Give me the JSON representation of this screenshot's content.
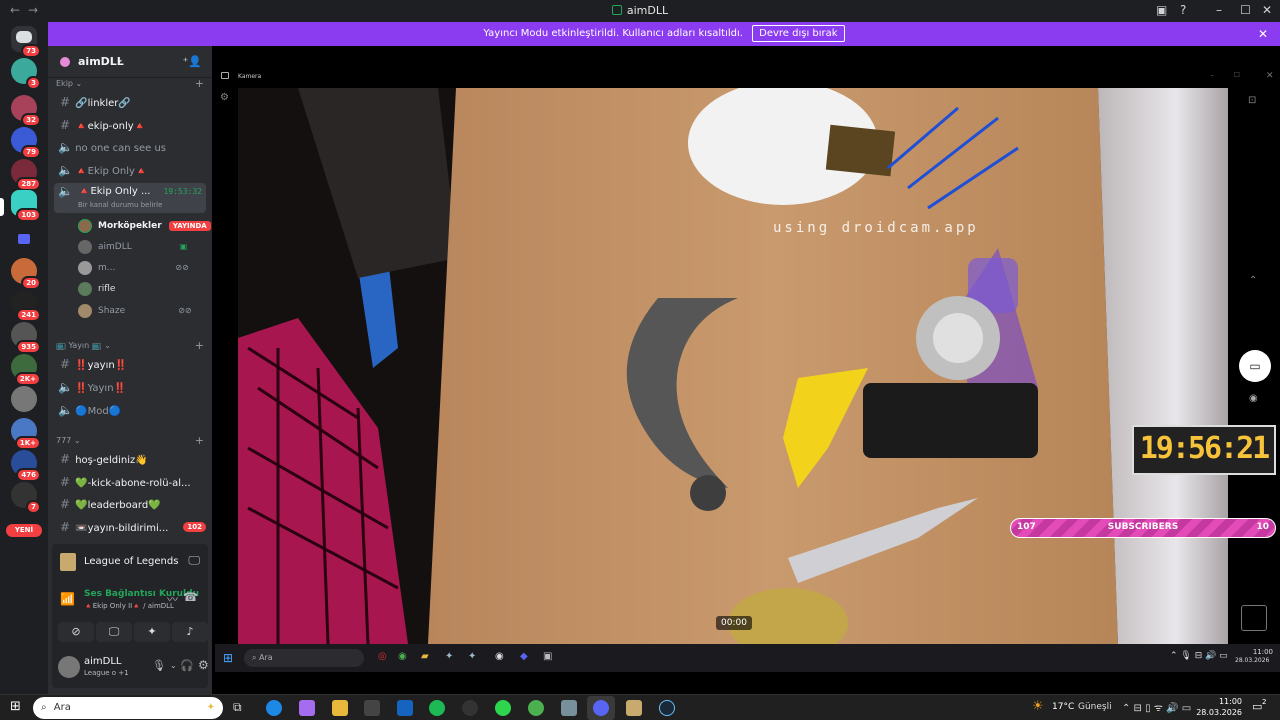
{
  "window": {
    "title": "aimDLL"
  },
  "banner": {
    "text": "Yayıncı Modu etkinleştirildi. Kullanıcı adları kısaltıldı.",
    "button": "Devre dışı bırak"
  },
  "rail": {
    "badges": [
      "73",
      "3",
      "32",
      "79",
      "287",
      "103",
      "20",
      "241",
      "935",
      "2K+",
      "1K+",
      "476",
      "7"
    ],
    "new_label": "YENİ"
  },
  "server": {
    "name": "aimDLL"
  },
  "categories": {
    "ekip": "Ekip",
    "yayin": "📺 Yayın 📺",
    "c777": "777"
  },
  "channels": {
    "linkler": "🔗linkler🔗",
    "ekip_only": "🔺ekip-only🔺",
    "no_one": "no one can see us",
    "ekip_only_voice": "🔺Ekip Only🔺",
    "ekip_only_active": "🔺Ekip Only ...",
    "active_time": "19:53:32",
    "active_status": "Bir kanal durumu belirle",
    "yayin1": "‼️yayın‼️",
    "yayin2": "‼️Yayın‼️",
    "mod": "🔵Mod🔵",
    "hos_geldiniz": "hoş-geldiniz👋",
    "kick_abone": "💚-kick-abone-rolü-al...",
    "leaderboard": "💚leaderboard💚",
    "yayin_bildirimi": "📼yayın-bildirimi...",
    "yayin_bildirimi_badge": "102"
  },
  "voice_users": [
    {
      "name": "Morköpekler",
      "live": "YAYINDA"
    },
    {
      "name": "aimDLL"
    },
    {
      "name": "m..."
    },
    {
      "name": "rifle"
    },
    {
      "name": "Shaze"
    }
  ],
  "activity": {
    "game": "League of Legends"
  },
  "voice_panel": {
    "status": "Ses Bağlantısı Kuruldu",
    "channel": "🔺Ekip Only II🔺 / aimDLL"
  },
  "user_panel": {
    "name": "aimDLL",
    "status": "League o +1"
  },
  "camera": {
    "window_title": "Kamera",
    "watermark": "using droidcam.app",
    "time_code": "00:00",
    "clock": "19:56:21",
    "subs_left": "107",
    "subs_label": "SUBSCRIBERS",
    "subs_right": "10"
  },
  "inner_taskbar": {
    "search": "Ara",
    "time": "11:00",
    "date": "28.03.2026"
  },
  "taskbar": {
    "search": "Ara",
    "weather_temp": "17°C",
    "weather_text": "Güneşli",
    "time": "11:00",
    "date": "28.03.2026",
    "notif_count": "2"
  }
}
